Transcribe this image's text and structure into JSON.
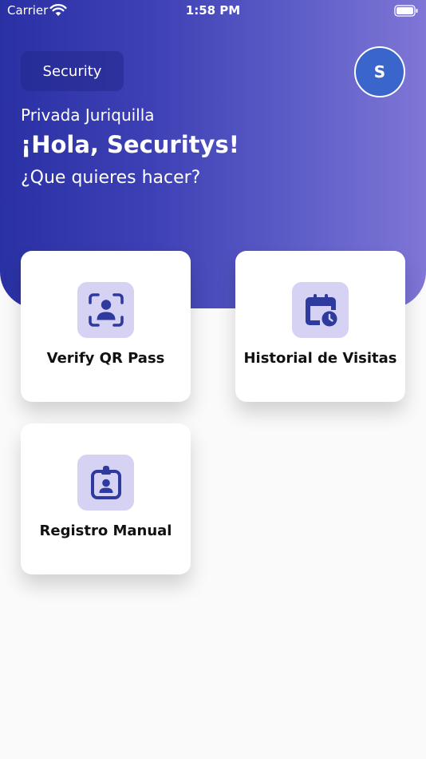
{
  "status_bar": {
    "carrier": "Carrier",
    "time": "1:58 PM"
  },
  "header": {
    "role_label": "Security",
    "avatar_initial": "S",
    "community": "Privada Juriquilla",
    "greeting": "¡Hola, Securitys!",
    "prompt": "¿Que quieres hacer?"
  },
  "actions": [
    {
      "label": "Verify QR Pass",
      "icon": "qr-scan-person-icon"
    },
    {
      "label": "Historial de Visitas",
      "icon": "calendar-clock-icon"
    },
    {
      "label": "Registro Manual",
      "icon": "id-badge-icon"
    }
  ],
  "colors": {
    "header_gradient_start": "#2a31a4",
    "header_gradient_end": "#7f76d6",
    "icon_tile": "#d6d2f4",
    "icon_fill": "#2f3a9e",
    "avatar": "#3a66cc"
  }
}
